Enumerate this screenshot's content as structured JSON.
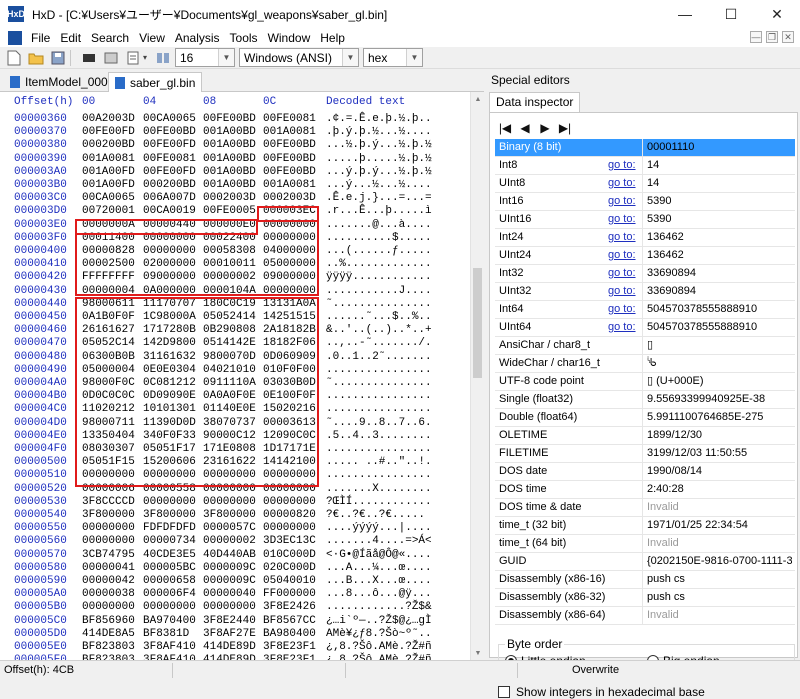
{
  "window": {
    "app_icon": "HxD",
    "title": "HxD - [C:¥Users¥ユーザー¥Documents¥gl_weapons¥saber_gl.bin]",
    "buttons": [
      "—",
      "☐",
      "✕"
    ]
  },
  "menu": {
    "items": [
      "File",
      "Edit",
      "Search",
      "View",
      "Analysis",
      "Tools",
      "Window",
      "Help"
    ],
    "mdi_buttons": [
      "—",
      "❐",
      "✕"
    ]
  },
  "toolbar": {
    "bytes_per_row": "16",
    "charset": "Windows (ANSI)",
    "offset_base": "hex"
  },
  "tabs": [
    {
      "label": "ItemModel_000.gj",
      "active": false
    },
    {
      "label": "saber_gl.bin",
      "active": true
    }
  ],
  "hex": {
    "header": {
      "offset": "Offset(h)",
      "c0": "00",
      "c1": "04",
      "c2": "08",
      "c3": "0C",
      "decoded": "Decoded text"
    },
    "rows": [
      {
        "off": "00000360",
        "g": [
          "00A2003D",
          "00CA0065",
          "00FE00BD",
          "00FE0081"
        ],
        "dec": ".¢.=.Ê.e.þ.½.þ.."
      },
      {
        "off": "00000370",
        "g": [
          "00FE00FD",
          "00FE00BD",
          "001A00BD",
          "001A0081"
        ],
        "dec": ".þ.ý.þ.½...½...."
      },
      {
        "off": "00000380",
        "g": [
          "000200BD",
          "00FE00FD",
          "001A00BD",
          "00FE00BD"
        ],
        "dec": "...½.þ.ý...½.þ.½"
      },
      {
        "off": "00000390",
        "g": [
          "001A0081",
          "00FE0081",
          "001A00BD",
          "00FE00BD"
        ],
        "dec": ".....þ.....½.þ.½"
      },
      {
        "off": "000003A0",
        "g": [
          "001A00FD",
          "00FE00FD",
          "001A00BD",
          "00FE00BD"
        ],
        "dec": "...ý.þ.ý...½.þ.½"
      },
      {
        "off": "000003B0",
        "g": [
          "001A00FD",
          "000200BD",
          "001A00BD",
          "001A0081"
        ],
        "dec": "...ý...½...½...."
      },
      {
        "off": "000003C0",
        "g": [
          "00CA0065",
          "006A007D",
          "0002003D",
          "0002003D"
        ],
        "dec": ".Ê.e.j.}...=...="
      },
      {
        "off": "000003D0",
        "g": [
          "00720001",
          "00CA0019",
          "00FE0005",
          "000003EC"
        ],
        "dec": ".r...Ê...þ.....ì"
      },
      {
        "off": "000003E0",
        "g": [
          "0000000A",
          "00000440",
          "000000E0",
          "00000000"
        ],
        "dec": ".......@...à...."
      },
      {
        "off": "000003F0",
        "g": [
          "00011400",
          "00000000",
          "00022400",
          "00000000"
        ],
        "dec": "..........$....."
      },
      {
        "off": "00000400",
        "g": [
          "00000828",
          "00000000",
          "00058308",
          "04000000"
        ],
        "dec": "...(......ƒ....."
      },
      {
        "off": "00000410",
        "g": [
          "00002500",
          "02000000",
          "00010011",
          "05000000"
        ],
        "dec": "..%............."
      },
      {
        "off": "00000420",
        "g": [
          "FFFFFFFF",
          "09000000",
          "00000002",
          "09000000"
        ],
        "dec": "ÿÿÿÿ............"
      },
      {
        "off": "00000430",
        "g": [
          "00000004",
          "0A000000",
          "0000104A",
          "00000000"
        ],
        "dec": "...........J...."
      },
      {
        "off": "00000440",
        "g": [
          "98000611",
          "11170707",
          "180C0C19",
          "13131A0A"
        ],
        "dec": "˜..............."
      },
      {
        "off": "00000450",
        "g": [
          "0A1B0F0F",
          "1C98000A",
          "05052414",
          "14251515"
        ],
        "dec": "......˜...$..%.."
      },
      {
        "off": "00000460",
        "g": [
          "26161627",
          "1717280B",
          "0B290808",
          "2A18182B"
        ],
        "dec": "&..'..(..)..*..+"
      },
      {
        "off": "00000470",
        "g": [
          "05052C14",
          "142D9800",
          "0514142E",
          "18182F06"
        ],
        "dec": "..,..-˜......./."
      },
      {
        "off": "00000480",
        "g": [
          "06300B0B",
          "31161632",
          "9800070D",
          "0D060909"
        ],
        "dec": ".0..1..2˜......."
      },
      {
        "off": "00000490",
        "g": [
          "05000004",
          "0E0E0304",
          "04021010",
          "010F0F00"
        ],
        "dec": "................"
      },
      {
        "off": "000004A0",
        "g": [
          "98000F0C",
          "0C081212",
          "0911110A",
          "03030B0D"
        ],
        "dec": "˜..............."
      },
      {
        "off": "000004B0",
        "g": [
          "0D0C0C0C",
          "0D09090E",
          "0A0A0F0E",
          "0E100F0F"
        ],
        "dec": "................"
      },
      {
        "off": "000004C0",
        "g": [
          "11020212",
          "10101301",
          "01140E0E",
          "15020216"
        ],
        "dec": "................"
      },
      {
        "off": "000004D0",
        "g": [
          "98000711",
          "11390D0D",
          "38070737",
          "00003613"
        ],
        "dec": "˜....9..8..7..6."
      },
      {
        "off": "000004E0",
        "g": [
          "13350404",
          "340F0F33",
          "90000C12",
          "12090C0C"
        ],
        "dec": ".5..4..3........"
      },
      {
        "off": "000004F0",
        "g": [
          "08030307",
          "05051F17",
          "171E0808",
          "1D17171E"
        ],
        "dec": "................"
      },
      {
        "off": "00000500",
        "g": [
          "05051F15",
          "15200606",
          "23161622",
          "14142100"
        ],
        "dec": "..... ..#..\"..!."
      },
      {
        "off": "00000510",
        "g": [
          "00000000",
          "00000000",
          "00000000",
          "00000000"
        ],
        "dec": "................"
      },
      {
        "off": "00000520",
        "g": [
          "00000006",
          "00000558",
          "00000000",
          "00000000"
        ],
        "dec": ".......X........"
      },
      {
        "off": "00000530",
        "g": [
          "3F8CCCCD",
          "00000000",
          "00000000",
          "00000000"
        ],
        "dec": "?ŒÌÍ............"
      },
      {
        "off": "00000540",
        "g": [
          "3F800000",
          "3F800000",
          "3F800000",
          "00000820"
        ],
        "dec": "?€..?€..?€..... "
      },
      {
        "off": "00000550",
        "g": [
          "00000000",
          "FDFDFDFD",
          "0000057C",
          "00000000"
        ],
        "dec": "....ýýýý...|...."
      },
      {
        "off": "00000560",
        "g": [
          "00000000",
          "00000734",
          "00000002",
          "3D3EC13C"
        ],
        "dec": ".......4....=>Á<"
      },
      {
        "off": "00000570",
        "g": [
          "3CB74795",
          "40CDE3E5",
          "40D440AB",
          "010C000D"
        ],
        "dec": "<·G•@Íãå@Ô@«...."
      },
      {
        "off": "00000580",
        "g": [
          "00000041",
          "000005BC",
          "0000009C",
          "020C000D"
        ],
        "dec": "...A...¼...œ...."
      },
      {
        "off": "00000590",
        "g": [
          "00000042",
          "00000658",
          "0000009C",
          "05040010"
        ],
        "dec": "...B...X...œ...."
      },
      {
        "off": "000005A0",
        "g": [
          "00000038",
          "000006F4",
          "00000040",
          "FF000000"
        ],
        "dec": "...8...ô...@ÿ..."
      },
      {
        "off": "000005B0",
        "g": [
          "00000000",
          "00000000",
          "00000000",
          "3F8E2426"
        ],
        "dec": "............?Ž$&"
      },
      {
        "off": "000005C0",
        "g": [
          "BF856960",
          "BA970400",
          "3F8E2440",
          "BF8567CC"
        ],
        "dec": "¿…i`º—..?Ž$@¿…gÌ"
      },
      {
        "off": "000005D0",
        "g": [
          "414DE8A5",
          "BF8381D",
          "3F8AF27E",
          "BA980400"
        ],
        "dec": "AMè¥¿ƒ8.?Šò~º˜.."
      },
      {
        "off": "000005E0",
        "g": [
          "BF823803",
          "3F8AF410",
          "414DE89D",
          "3F8E23F1"
        ],
        "dec": "¿‚8.?Šô.AMè.?Ž#ñ"
      },
      {
        "off": "000005F0",
        "g": [
          "BF823803",
          "3F8AF410",
          "414DE89D",
          "3F8E23F1"
        ],
        "dec": "¿‚8.?Šô.AMè.?Ž#ñ"
      }
    ]
  },
  "special_editors": {
    "title": "Special editors",
    "tab": "Data inspector",
    "nav": [
      "|◀",
      "◀",
      "▶",
      "▶|"
    ],
    "rows": [
      {
        "name": "Binary (8 bit)",
        "goto": "",
        "value": "00001110",
        "selected": true
      },
      {
        "name": "Int8",
        "goto": "go to:",
        "value": "14"
      },
      {
        "name": "UInt8",
        "goto": "go to:",
        "value": "14"
      },
      {
        "name": "Int16",
        "goto": "go to:",
        "value": "5390"
      },
      {
        "name": "UInt16",
        "goto": "go to:",
        "value": "5390"
      },
      {
        "name": "Int24",
        "goto": "go to:",
        "value": "136462"
      },
      {
        "name": "UInt24",
        "goto": "go to:",
        "value": "136462"
      },
      {
        "name": "Int32",
        "goto": "go to:",
        "value": "33690894"
      },
      {
        "name": "UInt32",
        "goto": "go to:",
        "value": "33690894"
      },
      {
        "name": "Int64",
        "goto": "go to:",
        "value": "504570378555888910"
      },
      {
        "name": "UInt64",
        "goto": "go to:",
        "value": "504570378555888910"
      },
      {
        "name": "AnsiChar / char8_t",
        "goto": "",
        "value": "▯"
      },
      {
        "name": "WideChar / char16_t",
        "goto": "",
        "value": "ᔎ"
      },
      {
        "name": "UTF-8 code point",
        "goto": "",
        "value": "▯ (U+000E)"
      },
      {
        "name": "Single (float32)",
        "goto": "",
        "value": "9.55693399940925E-38"
      },
      {
        "name": "Double (float64)",
        "goto": "",
        "value": "5.9911100764685E-275"
      },
      {
        "name": "OLETIME",
        "goto": "",
        "value": "1899/12/30"
      },
      {
        "name": "FILETIME",
        "goto": "",
        "value": "3199/12/03 11:50:55"
      },
      {
        "name": "DOS date",
        "goto": "",
        "value": "1990/08/14"
      },
      {
        "name": "DOS time",
        "goto": "",
        "value": "2:40:28"
      },
      {
        "name": "DOS time & date",
        "goto": "",
        "value": "Invalid",
        "invalid": true
      },
      {
        "name": "time_t (32 bit)",
        "goto": "",
        "value": "1971/01/25 22:34:54"
      },
      {
        "name": "time_t (64 bit)",
        "goto": "",
        "value": "Invalid",
        "invalid": true
      },
      {
        "name": "GUID",
        "goto": "",
        "value": "{0202150E-9816-0700-1111-390D0D3807"
      },
      {
        "name": "Disassembly (x86-16)",
        "goto": "",
        "value": "push cs"
      },
      {
        "name": "Disassembly (x86-32)",
        "goto": "",
        "value": "push cs"
      },
      {
        "name": "Disassembly (x86-64)",
        "goto": "",
        "value": "Invalid",
        "invalid": true
      }
    ],
    "byte_order": {
      "legend": "Byte order",
      "little": "Little endian",
      "big": "Big endian",
      "selected": "little"
    },
    "hex_checkbox": "Show integers in hexadecimal base"
  },
  "status": {
    "offset": "Offset(h): 4CB",
    "mode": "Overwrite"
  }
}
